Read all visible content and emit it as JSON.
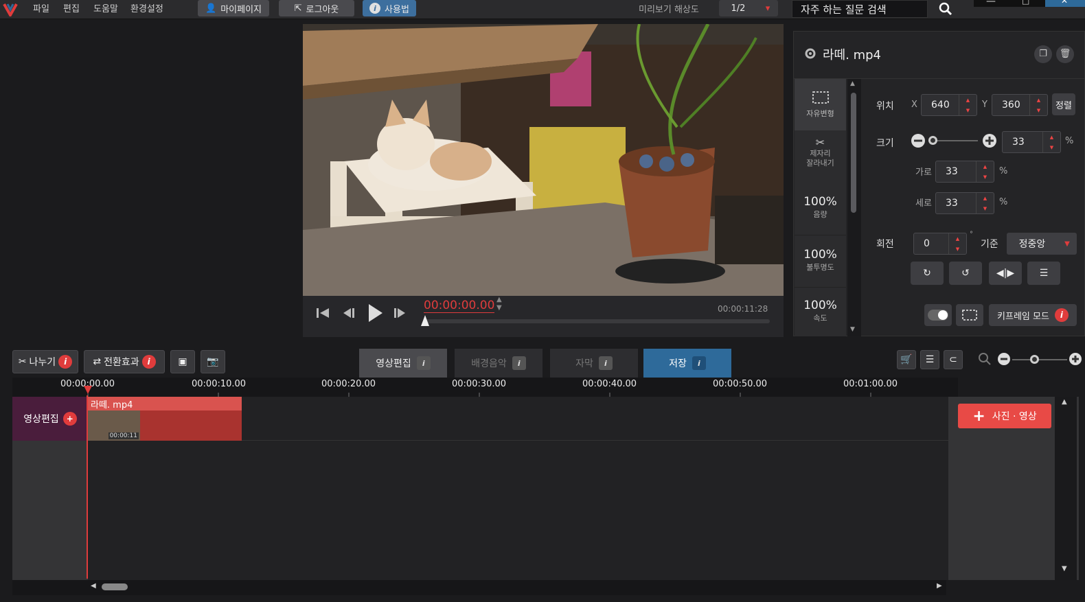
{
  "menu": {
    "items": [
      "파일",
      "편집",
      "도움말",
      "환경설정"
    ]
  },
  "toolbar": {
    "mypage_label": "마이페이지",
    "logout_label": "로그아웃",
    "howto_label": "사용법",
    "resolution_label": "미리보기 해상도",
    "resolution_value": "1/2",
    "faq_placeholder": "자주 하는 질문 검색"
  },
  "player": {
    "current_time": "00:00:00.00",
    "total_time": "00:00:11:28"
  },
  "panel": {
    "file_name": "라떼. mp4",
    "side": {
      "free_transform": "자유변형",
      "crop_label": "제자리\n잘라내기",
      "volume_value": "100%",
      "volume_label": "음량",
      "opacity_value": "100%",
      "opacity_label": "불투명도",
      "speed_value": "100%",
      "speed_label": "속도"
    },
    "position_label": "위치",
    "x_label": "X",
    "x_value": "640",
    "y_label": "Y",
    "y_value": "360",
    "align_label": "정렬",
    "size_label": "크기",
    "size_value": "33",
    "percent": "%",
    "width_label": "가로",
    "width_value": "33",
    "height_label": "세로",
    "height_value": "33",
    "rotate_label": "회전",
    "rotate_value": "0",
    "degree": "°",
    "anchor_label": "기준",
    "anchor_value": "정중앙",
    "keyframe_label": "키프레임 모드"
  },
  "timeline": {
    "split_label": "나누기",
    "transition_label": "전환효과",
    "tabs": [
      "영상편집",
      "배경음악",
      "자막",
      "저장"
    ],
    "ticks": [
      "00:00:00.00",
      "00:00:10.00",
      "00:00:20.00",
      "00:00:30.00",
      "00:00:40.00",
      "00:00:50.00",
      "00:01:00.00"
    ],
    "track_label": "영상편집",
    "clip_name": "라떼. mp4",
    "clip_duration": "00:00:11",
    "add_media_label": "사진 · 영상"
  },
  "colors": {
    "accent_red": "#e03c3c",
    "accent_blue": "#2e6a9a",
    "clip_red": "#d9534f"
  }
}
